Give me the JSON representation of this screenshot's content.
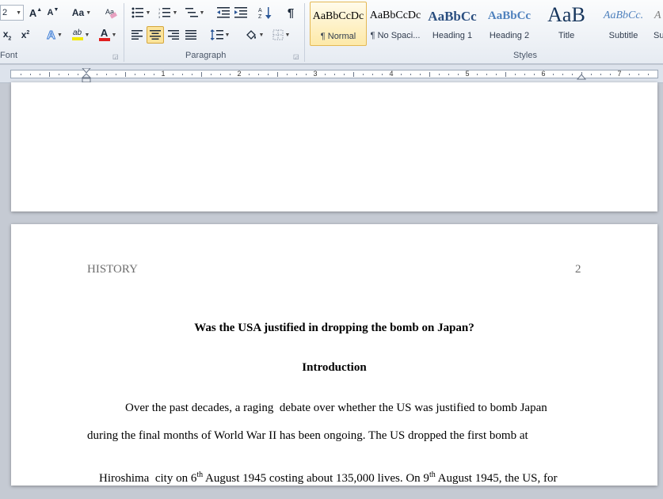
{
  "ribbon": {
    "font_size_value": "2",
    "groups": {
      "font": "Font",
      "paragraph": "Paragraph",
      "styles": "Styles"
    },
    "font_buttons": {
      "grow": "A",
      "shrink": "A",
      "change_case": "Aa",
      "subscript": "x",
      "subscript_mark": "2",
      "superscript": "x",
      "superscript_mark": "2",
      "text_effects": "A",
      "highlight": "ab",
      "font_color": "A"
    },
    "styles": [
      {
        "preview": "AaBbCcDc",
        "name": "¶ Normal"
      },
      {
        "preview": "AaBbCcDc",
        "name": "¶ No Spaci..."
      },
      {
        "preview": "AaBbCc",
        "name": "Heading 1"
      },
      {
        "preview": "AaBbCc",
        "name": "Heading 2"
      },
      {
        "preview": "AaB",
        "name": "Title"
      },
      {
        "preview": "AaBbCc.",
        "name": "Subtitle"
      },
      {
        "preview": "A",
        "name": "Su"
      }
    ],
    "colors": {
      "highlight": "#f2e900",
      "font_color": "#e02020",
      "accent": "#2b5797"
    }
  },
  "ruler": {
    "numbers": [
      "1",
      "2",
      "3",
      "4",
      "5",
      "6",
      "7"
    ]
  },
  "document": {
    "header_left": "HISTORY",
    "page_number": "2",
    "title": "Was the USA justified in dropping the bomb on Japan?",
    "heading": "Introduction",
    "line1": "Over the past decades, a raging  debate over whether the US was justified to bomb Japan",
    "line2": "during the final months of World War II has been ongoing. The US dropped the first bomb at",
    "line3_a": "Hiroshima  city on 6",
    "line3_sup1": "th",
    "line3_b": " August 1945 costing about 135,000 lives. On 9",
    "line3_sup2": "th",
    "line3_c": " August 1945, the US, for"
  }
}
